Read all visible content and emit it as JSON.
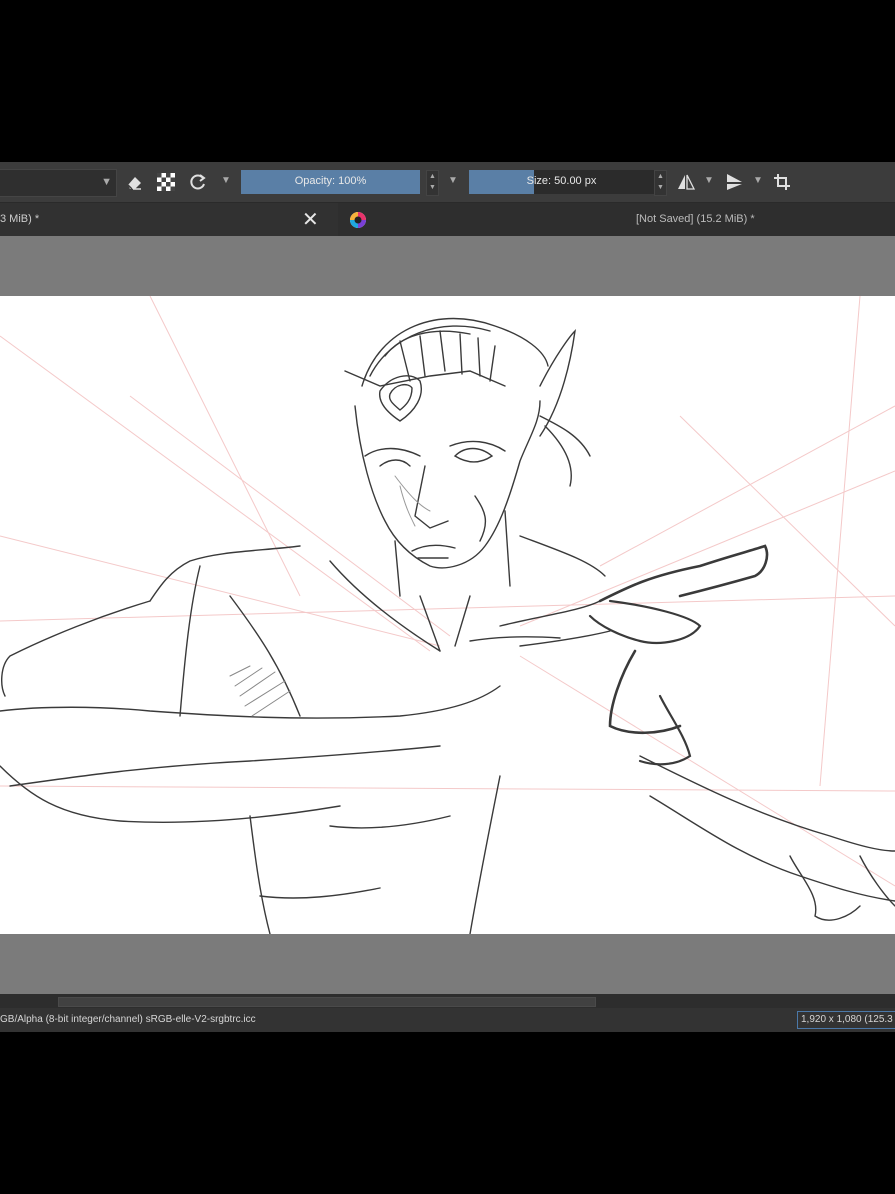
{
  "toolbar": {
    "opacity_label": "Opacity: 100%",
    "opacity_value": 1.0,
    "size_label": "Size: 50.00 px",
    "size_fill": 0.35,
    "icons": [
      "eraser-icon",
      "alpha-lock-icon",
      "reload-preset-icon",
      "mirror-horizontal-icon",
      "mirror-vertical-icon",
      "wrap-around-icon"
    ]
  },
  "tabs": [
    {
      "title": "3 MiB) *"
    },
    {
      "title": "[Not Saved]  (15.2 MiB) *"
    }
  ],
  "status": {
    "color_profile": "GB/Alpha (8-bit integer/channel)  sRGB-elle-V2-srgbtrc.icc",
    "image_size": "1,920 x 1,080 (125.3 M"
  },
  "colors": {
    "accent": "#5a7fa6",
    "toolbar_bg": "#3c3c3c",
    "canvas_bg": "#7b7b7b",
    "guide_lines": "#f4c9c9"
  }
}
